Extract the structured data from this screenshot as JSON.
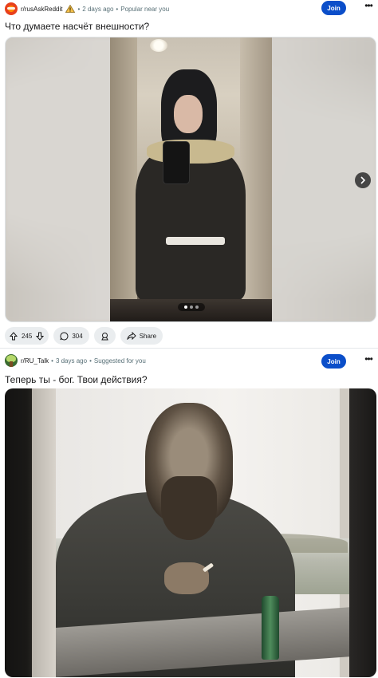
{
  "posts": [
    {
      "subreddit": "r/rusAskReddit",
      "time": "2 days ago",
      "context": "Popular near you",
      "join_label": "Join",
      "more_label": "•••",
      "title": "Что думаете насчёт внешности?",
      "image_icon": "photo-selfie-mirror",
      "carousel": {
        "count": 3,
        "active": 1
      },
      "score": "245",
      "comments": "304",
      "share_label": "Share"
    },
    {
      "subreddit": "r/RU_Talk",
      "time": "3 days ago",
      "context": "Suggested for you",
      "join_label": "Join",
      "more_label": "•••",
      "title": "Теперь ты - бог. Твои действия?",
      "image_icon": "painting-man-smoking"
    }
  ],
  "separator": "•",
  "colors": {
    "join_button": "#0b4ec9",
    "pill_background": "#eaedef",
    "meta_text": "#576f76",
    "warning_icon": "#f5c04a"
  }
}
